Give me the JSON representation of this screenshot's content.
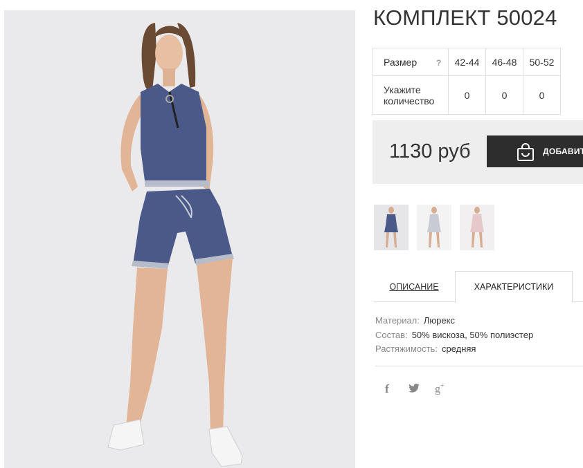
{
  "product": {
    "title": "КОМПЛЕКТ 50024"
  },
  "size_table": {
    "size_label": "Размер",
    "help_icon": "?",
    "sizes": [
      "42-44",
      "46-48",
      "50-52"
    ],
    "quantity_label_1": "Укажите",
    "quantity_label_2": "количество",
    "quantities": [
      "0",
      "0",
      "0"
    ]
  },
  "purchase": {
    "price": "1130 руб",
    "cart_button_label": "ДОБАВИТЬ В КОРЗИНУ",
    "cart_icon": "shopping-bag-icon"
  },
  "thumbnails": [
    "thumbnail-blue-set",
    "thumbnail-light-set",
    "thumbnail-pink-set"
  ],
  "tabs": {
    "description": "ОПИСАНИЕ",
    "characteristics": "ХАРАКТЕРИСТИКИ",
    "active": "characteristics"
  },
  "specs": [
    {
      "key": "Материал:",
      "value": "Люрекс"
    },
    {
      "key": "Состав:",
      "value": "50% вискоза, 50% полиэстер"
    },
    {
      "key": "Растяжимость:",
      "value": "средняя"
    }
  ],
  "social": {
    "facebook": "f",
    "google_plus": "g",
    "google_plus_sup": "+"
  },
  "colors": {
    "photo_bg": "#eaeaec",
    "price_box_bg": "#eeeeee",
    "button_bg": "#2d2d2d",
    "denim": "#4a5987"
  }
}
